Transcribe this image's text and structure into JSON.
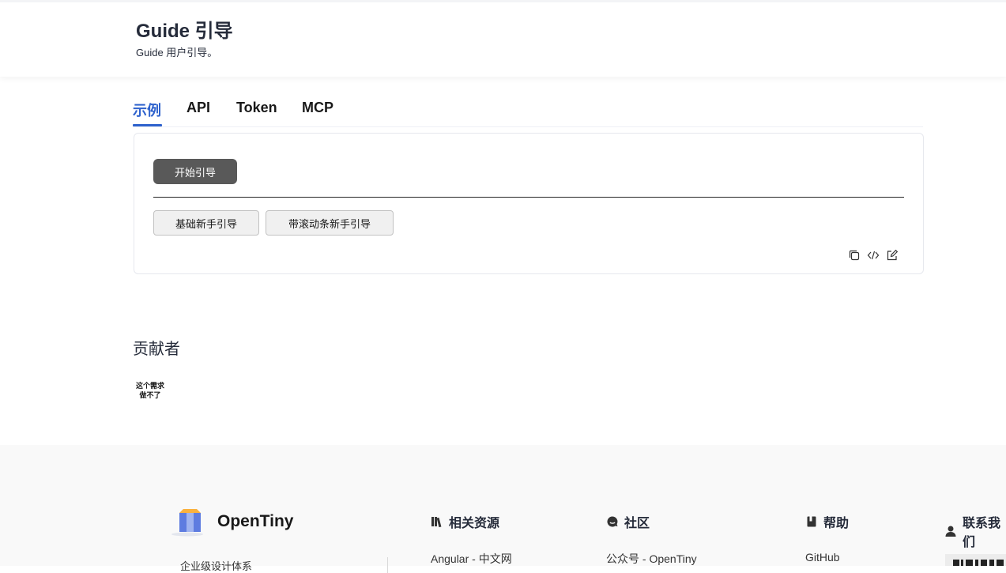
{
  "header": {
    "title": "Guide 引导",
    "subtitle": "Guide 用户引导。"
  },
  "tabs": [
    {
      "label": "示例",
      "active": true
    },
    {
      "label": "API",
      "active": false
    },
    {
      "label": "Token",
      "active": false
    },
    {
      "label": "MCP",
      "active": false
    }
  ],
  "demo": {
    "start_button": "开始引导",
    "buttons": [
      "基础新手引导",
      "带滚动条新手引导"
    ],
    "tools": [
      "copy-icon",
      "code-icon",
      "edit-icon"
    ]
  },
  "contributors": {
    "title": "贡献者",
    "avatar_text": "这个需求做不了"
  },
  "footer": {
    "brand": "OpenTiny",
    "slogan": "企业级设计体系",
    "columns": [
      {
        "title": "相关资源",
        "icon": "books-icon",
        "first_link": "Angular - 中文网"
      },
      {
        "title": "社区",
        "icon": "chat-icon",
        "first_link": "公众号 - OpenTiny"
      },
      {
        "title": "帮助",
        "icon": "book-icon",
        "first_link": "GitHub"
      },
      {
        "title": "联系我们",
        "icon": "user-icon",
        "first_link": ""
      }
    ]
  },
  "colors": {
    "accent": "#2e62cd",
    "primary_button": "#595959"
  }
}
